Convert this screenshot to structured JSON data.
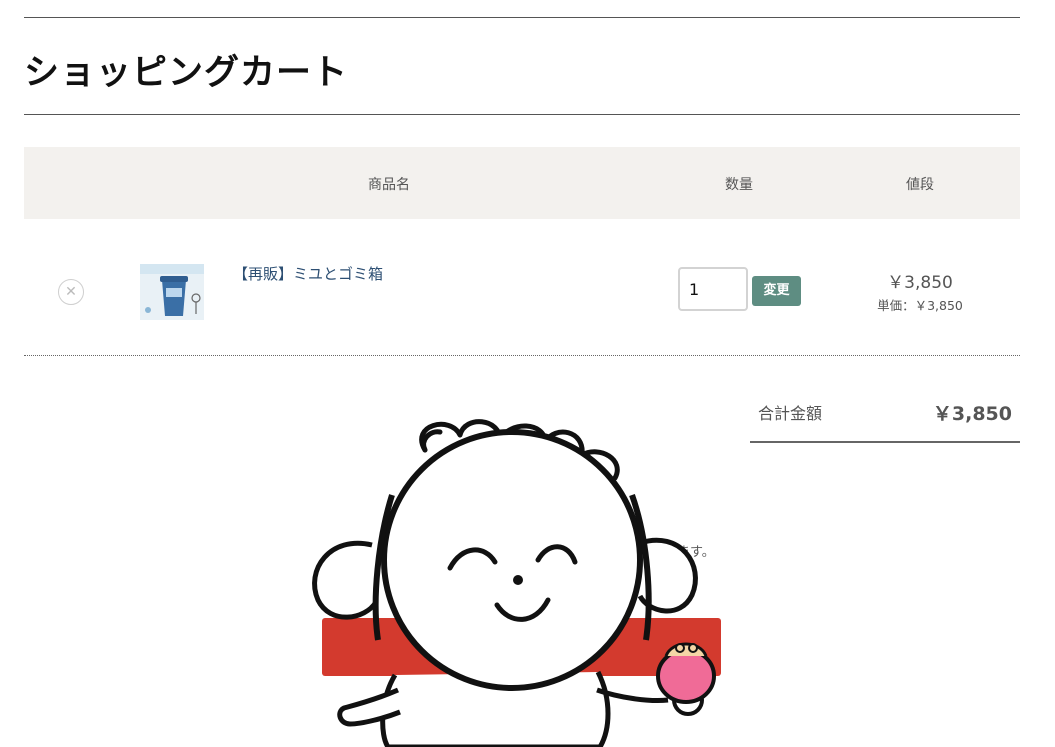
{
  "page": {
    "title": "ショッピングカート"
  },
  "table": {
    "headers": {
      "product": "商品名",
      "quantity": "数量",
      "price": "値段"
    }
  },
  "cart_items": [
    {
      "remove_icon": "close-circle-icon",
      "name": "【再販】ミユとゴミ箱",
      "quantity": "1",
      "update_label": "変更",
      "price": "￥3,850",
      "unit_price": "単価：￥3,850"
    }
  ],
  "summary": {
    "total_label": "合計金額",
    "total_value": "￥3,850"
  },
  "notice": {
    "text": "ます。"
  },
  "colors": {
    "update_button": "#5e8d82",
    "checkout_button": "#d33a2e",
    "table_header_bg": "#f3f1ee",
    "product_link": "#2d4f73",
    "purse": "#f06b97"
  }
}
